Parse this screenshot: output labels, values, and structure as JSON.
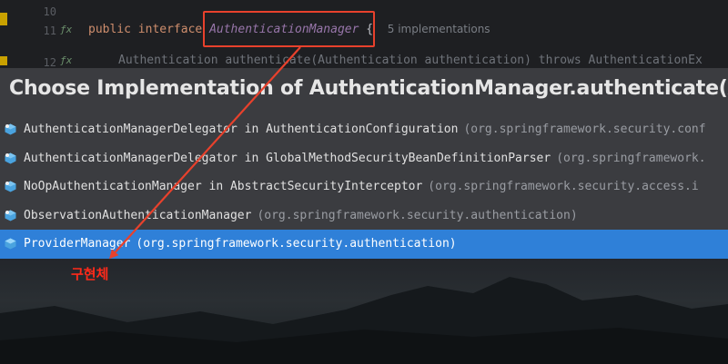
{
  "editor": {
    "line_10": "10",
    "line_11": "11",
    "line_12": "12",
    "keyword_public": "public",
    "keyword_interface": "interface",
    "interface_name": "AuthenticationManager",
    "brace": "{",
    "implementations_hint": "5 implementations",
    "line12_code": "Authentication authenticate(Authentication authentication) throws AuthenticationEx"
  },
  "popup": {
    "title": "Choose Implementation of AuthenticationManager.authenticate(Auth",
    "items": [
      {
        "name": "AuthenticationManagerDelegator in AuthenticationConfiguration",
        "package": "(org.springframework.security.conf",
        "selected": false
      },
      {
        "name": "AuthenticationManagerDelegator in GlobalMethodSecurityBeanDefinitionParser",
        "package": "(org.springframework.",
        "selected": false
      },
      {
        "name": "NoOpAuthenticationManager in AbstractSecurityInterceptor",
        "package": "(org.springframework.security.access.i",
        "selected": false
      },
      {
        "name": "ObservationAuthenticationManager",
        "package": "(org.springframework.security.authentication)",
        "selected": false
      },
      {
        "name": "ProviderManager",
        "package": "(org.springframework.security.authentication)",
        "selected": true
      }
    ]
  },
  "annotation": {
    "text": "구현체"
  },
  "colors": {
    "accent_red": "#e8412c",
    "selection_blue": "#2f80d8",
    "class_icon": "#4aa3df"
  }
}
